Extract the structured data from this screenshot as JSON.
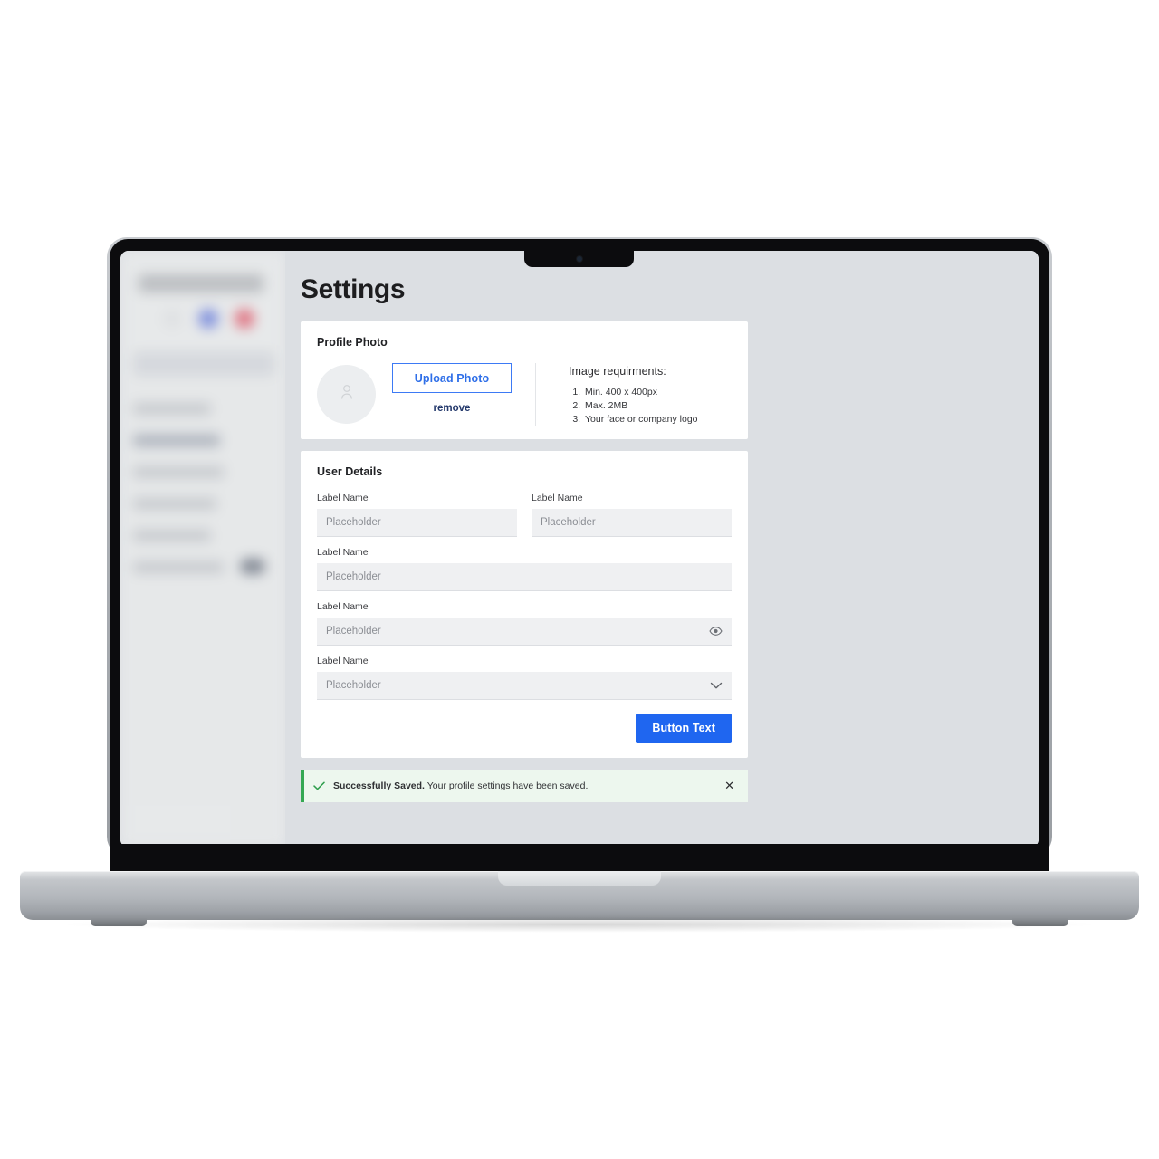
{
  "page": {
    "title": "Settings"
  },
  "sidebar": {
    "blurred": true,
    "items": [
      "",
      "",
      "",
      "",
      "",
      ""
    ]
  },
  "profile_card": {
    "title": "Profile Photo",
    "avatar_icon": "person-icon",
    "upload_label": "Upload Photo",
    "remove_label": "remove",
    "requirements_title": "Image requirments:",
    "requirements": [
      "Min.  400 x 400px",
      "Max. 2MB",
      "Your face or company logo"
    ]
  },
  "details_card": {
    "title": "User Details",
    "fields": [
      {
        "label": "Label Name",
        "placeholder": "Placeholder",
        "value": "",
        "width": "half",
        "icon": ""
      },
      {
        "label": "Label Name",
        "placeholder": "Placeholder",
        "value": "",
        "width": "half",
        "icon": ""
      },
      {
        "label": "Label Name",
        "placeholder": "Placeholder",
        "value": "",
        "width": "full",
        "icon": ""
      },
      {
        "label": "Label Name",
        "placeholder": "Placeholder",
        "value": "",
        "width": "full",
        "icon": "eye-icon"
      },
      {
        "label": "Label Name",
        "placeholder": "Placeholder",
        "value": "",
        "width": "full",
        "icon": "chevron-down-icon"
      }
    ],
    "submit_label": "Button Text"
  },
  "alert": {
    "icon": "check-icon",
    "title": "Successfully Saved.",
    "message": "Your profile settings have been saved.",
    "close_label": "✕"
  },
  "colors": {
    "accent_blue": "#1f66f0",
    "outline_blue": "#3d7af5",
    "link_navy": "#23386b",
    "success_green": "#35a853",
    "alert_bg": "#edf7ee",
    "screen_bg": "#dcdfe3",
    "card_bg": "#ffffff",
    "input_bg": "#eff0f2"
  }
}
